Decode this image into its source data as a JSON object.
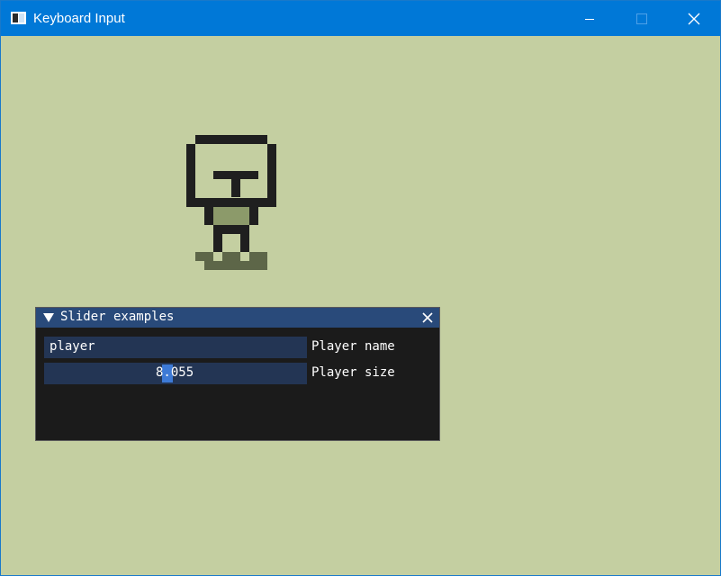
{
  "window": {
    "title": "Keyboard Input",
    "background_color": "#c4cfa1",
    "titlebar_color": "#0078d7",
    "icons": {
      "app": "app-window-icon",
      "minimize": "minimize-icon",
      "maximize": "maximize-icon",
      "close": "close-icon"
    }
  },
  "scene": {
    "sprite": "robot-player-sprite"
  },
  "panel": {
    "title": "Slider examples",
    "collapse_icon": "triangle-down-icon",
    "close_icon": "close-icon",
    "title_color": "#294a7a",
    "field_color": "#233554",
    "fields": [
      {
        "value": "player",
        "label": "Player name"
      },
      {
        "value": "8.055",
        "label": "Player size"
      }
    ]
  }
}
